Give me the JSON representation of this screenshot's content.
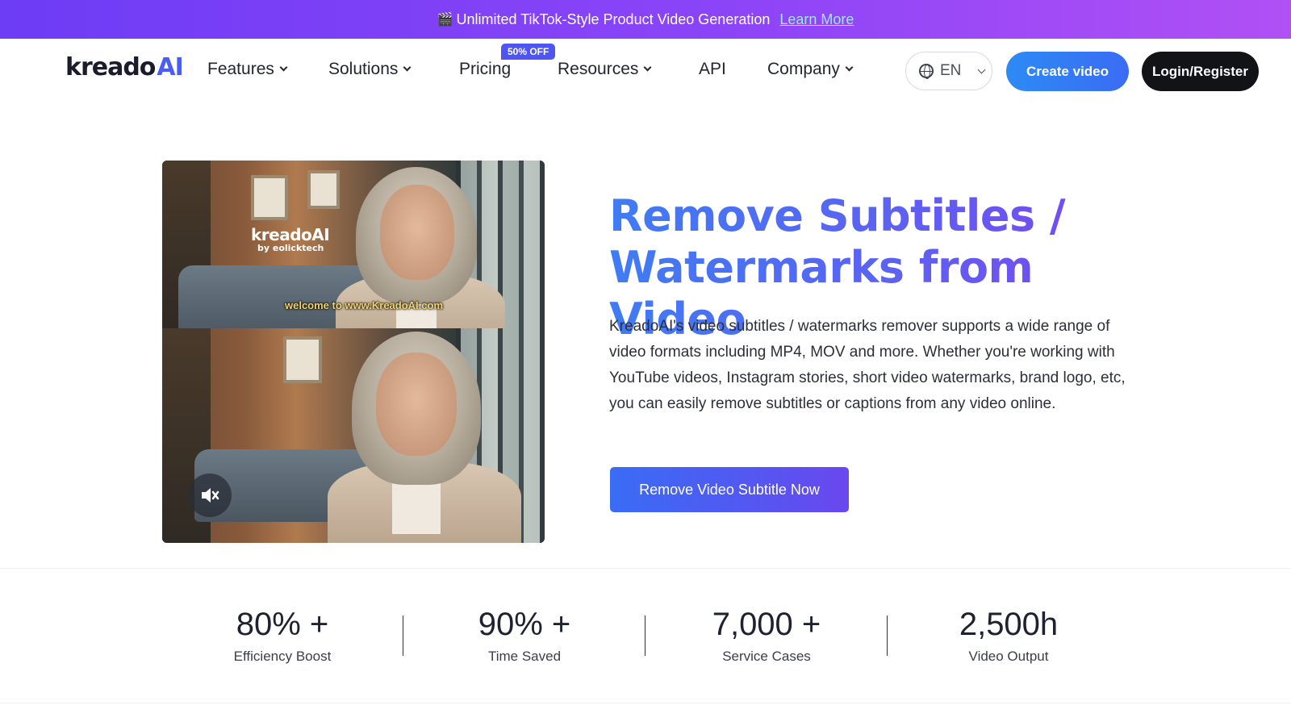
{
  "banner": {
    "icon": "clapperboard-icon",
    "text": "Unlimited TikTok-Style Product Video Generation",
    "link": "Learn More"
  },
  "nav": {
    "logo_main": "kreado",
    "logo_ai": "AI",
    "items": [
      {
        "label": "Features"
      },
      {
        "label": "Solutions"
      },
      {
        "label": "Pricing"
      },
      {
        "label": "Resources"
      },
      {
        "label": "API"
      },
      {
        "label": "Company"
      }
    ],
    "pricing_badge": "50% OFF",
    "language": "EN",
    "create_video": "Create video",
    "login": "Login/Register"
  },
  "video": {
    "watermark_logo": "kreadoAI",
    "watermark_sub": "by eolicktech",
    "caption": "welcome to www.KreadoAI.com",
    "mute_icon": "speaker-muted-icon"
  },
  "hero": {
    "title_line1": "Remove Subtitles /",
    "title_line2": "Watermarks from Video",
    "description": "KreadoAI's video subtitles / watermarks remover supports a wide range of video formats including MP4, MOV and more. Whether you're working with YouTube videos, Instagram stories, short video watermarks, brand logo, etc, you can easily remove subtitles or captions from any video online.",
    "cta": "Remove Video Subtitle Now"
  },
  "stats": [
    {
      "value": "80% +",
      "label": "Efficiency Boost"
    },
    {
      "value": "90% +",
      "label": "Time Saved"
    },
    {
      "value": "7,000 +",
      "label": "Service Cases"
    },
    {
      "value": "2,500h",
      "label": "Video Output"
    }
  ],
  "colors": {
    "banner_start": "#6d3cf5",
    "banner_end": "#b050f5",
    "accent_blue": "#3b6cf4",
    "accent_purple": "#7b46f0",
    "dark_button": "#121316"
  }
}
